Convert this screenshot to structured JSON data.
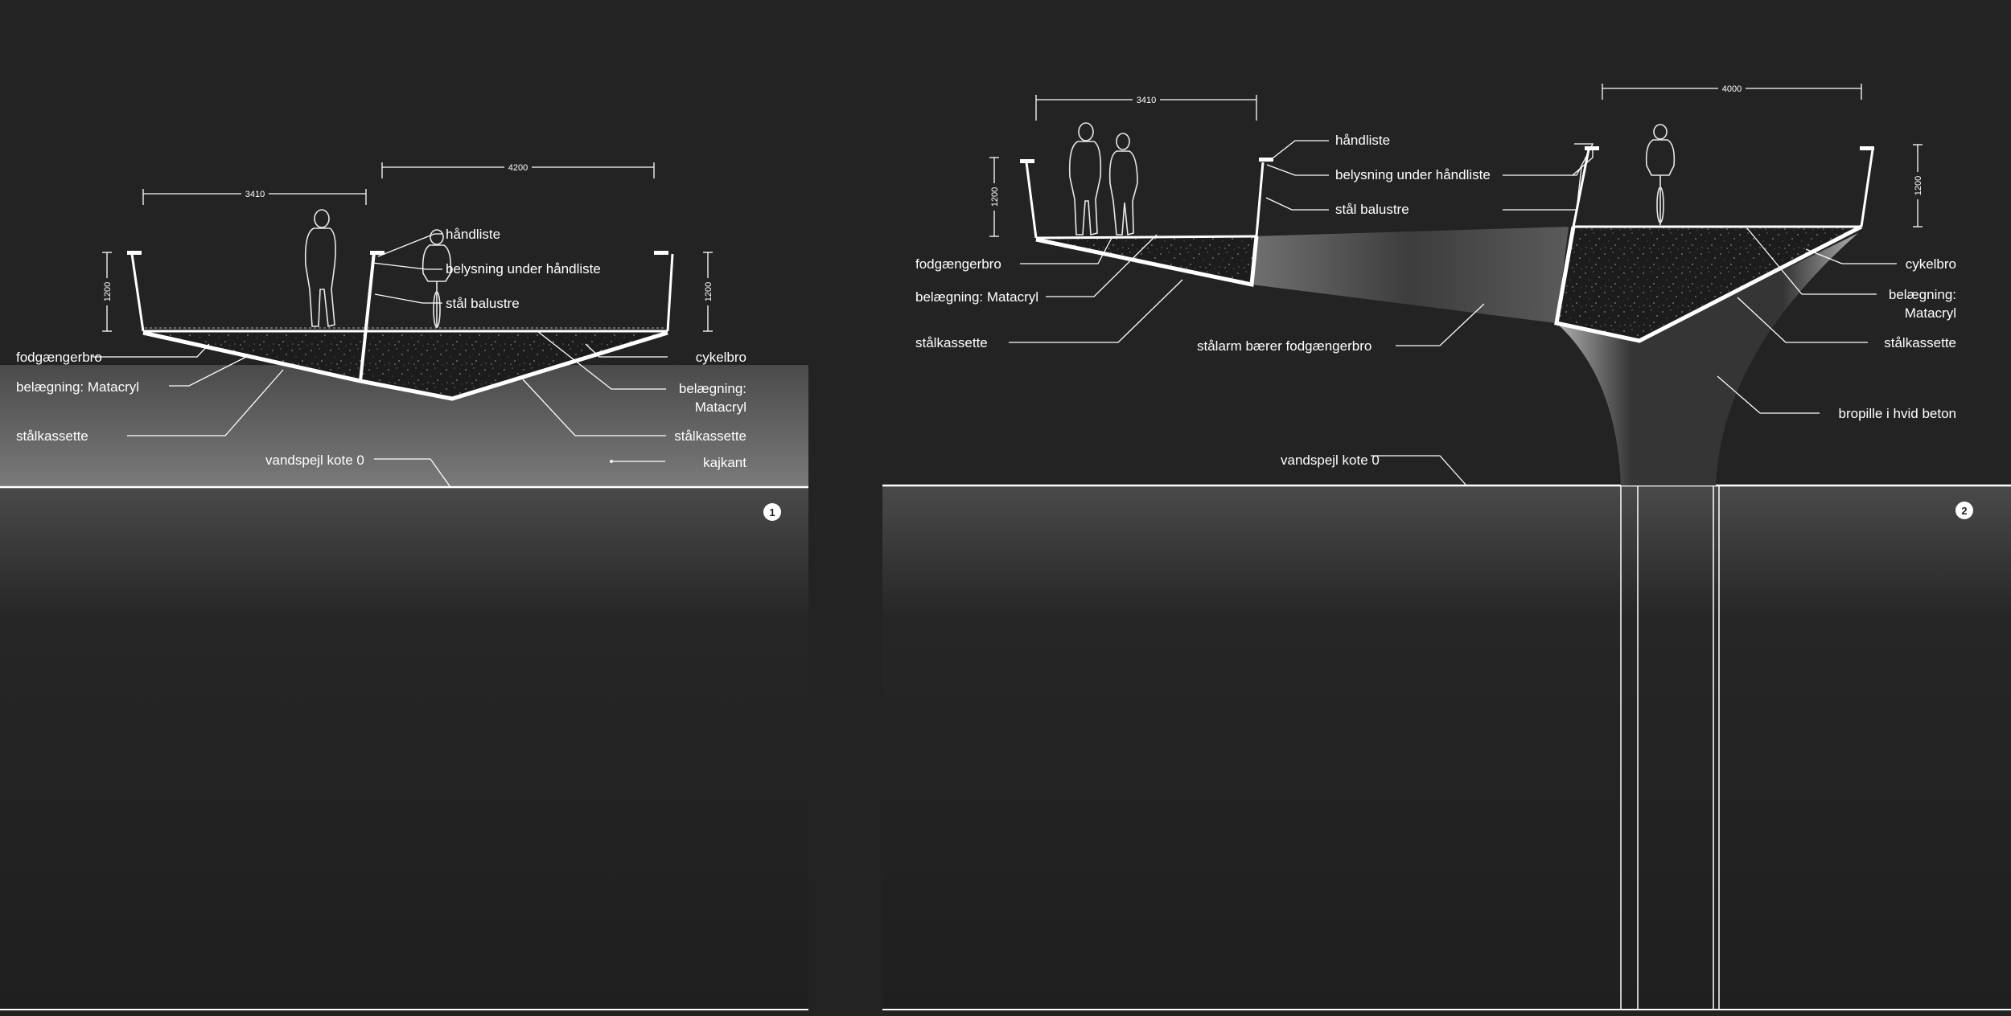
{
  "panel1": {
    "number": "1",
    "dims": {
      "pedestrian_width": "3410",
      "cycle_width": "4200",
      "rail_height_left": "1200",
      "rail_height_right": "1200"
    },
    "labels": {
      "handliste": "håndliste",
      "belysning": "belysning under håndliste",
      "balustre": "stål balustre",
      "fodgaengerbro": "fodgængerbro",
      "belaegning_left": "belægning: Matacryl",
      "stalkassette_left": "stålkassette",
      "vandspejl": "vandspejl kote 0",
      "cykelbro": "cykelbro",
      "belaegning_right_1": "belægning:",
      "belaegning_right_2": "Matacryl",
      "stalkassette_right": "stålkassette",
      "kajkant": "kajkant"
    }
  },
  "panel2": {
    "number": "2",
    "dims": {
      "pedestrian_width": "3410",
      "cycle_width": "4000",
      "rail_height": "1200",
      "rail_height_right": "1200"
    },
    "labels": {
      "handliste": "håndliste",
      "belysning": "belysning under håndliste",
      "balustre": "stål balustre",
      "fodgaengerbro": "fodgængerbro",
      "belaegning_left": "belægning: Matacryl",
      "stalkassette_left": "stålkassette",
      "stalarm": "stålarm bærer fodgængerbro",
      "vandspejl": "vandspejl kote 0",
      "cykelbro": "cykelbro",
      "belaegning_right_1": "belægning:",
      "belaegning_right_2": "Matacryl",
      "stalkassette_right": "stålkassette",
      "bropille": "bropille i hvid beton"
    }
  },
  "colors": {
    "background": "#232323",
    "line": "#ffffff",
    "water_top": "#3a3a3a",
    "quay": "#6a6a6a"
  }
}
